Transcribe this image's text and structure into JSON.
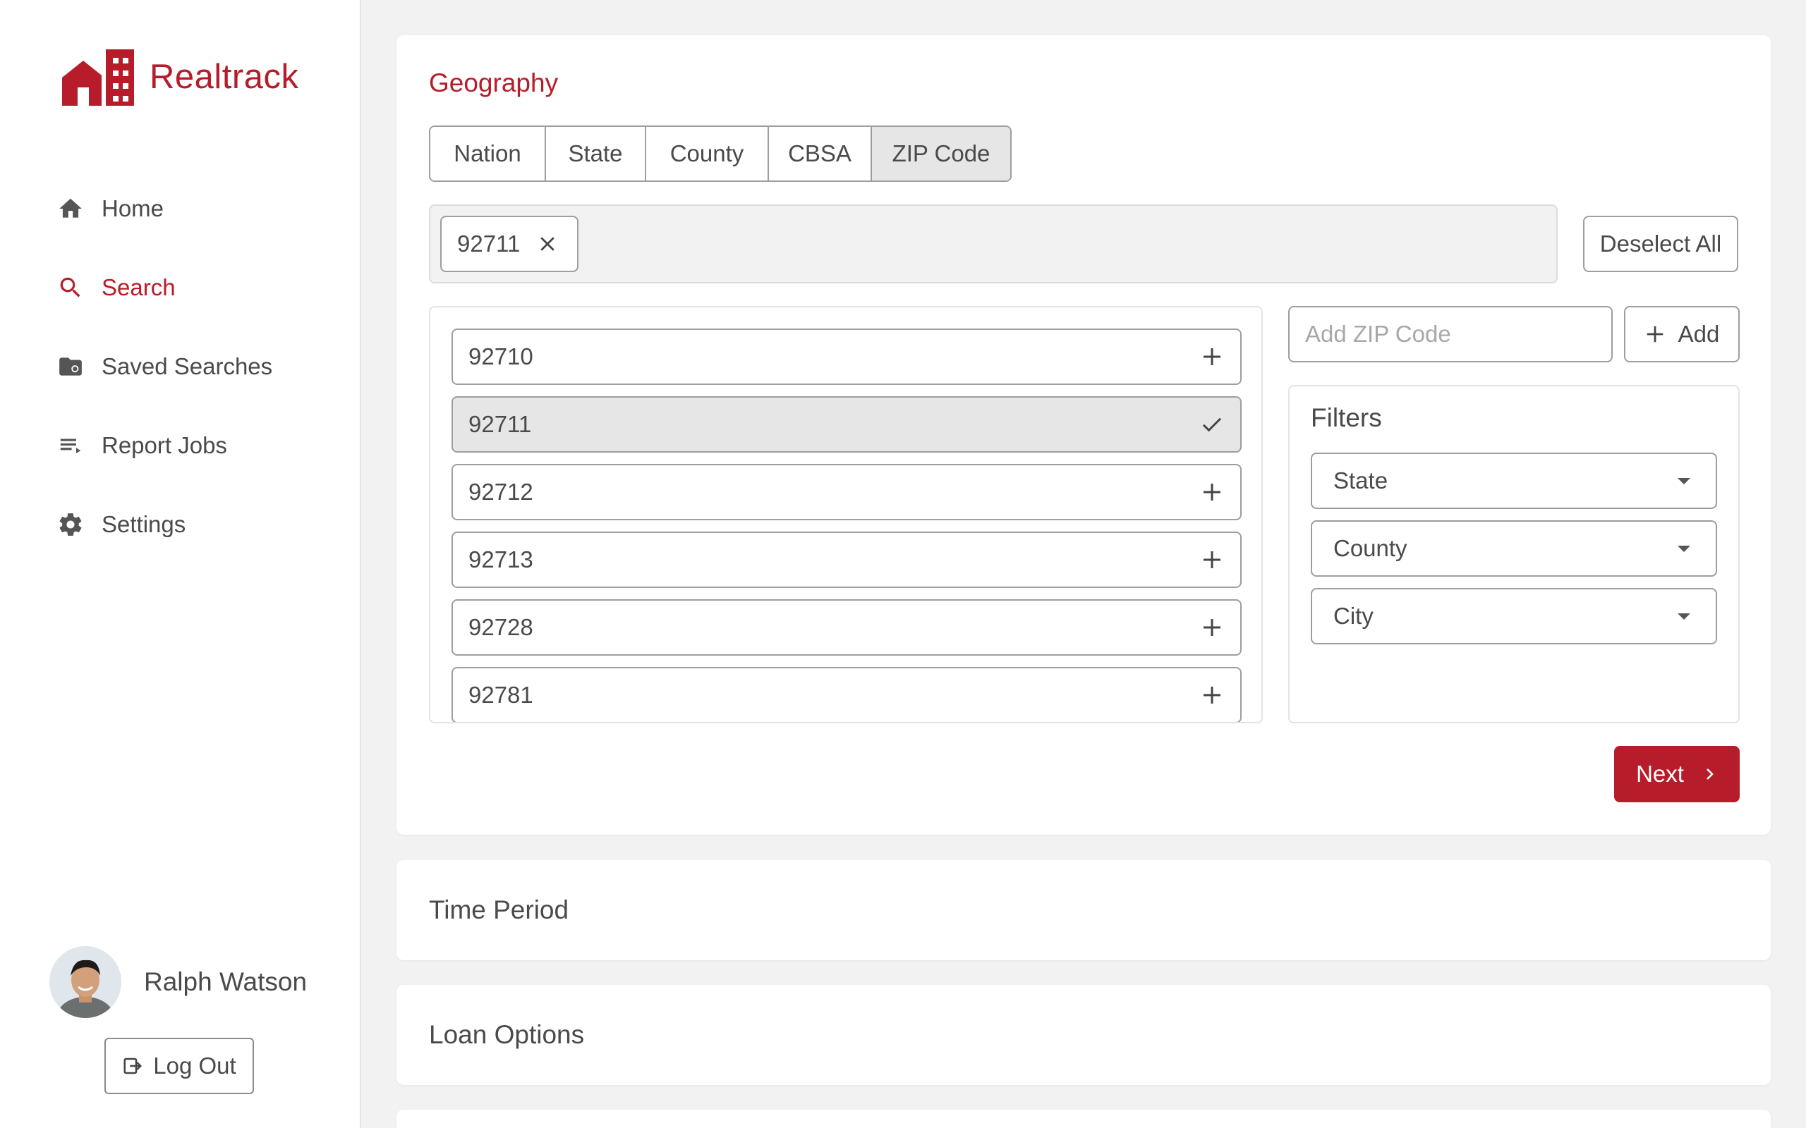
{
  "app": {
    "name": "Realtrack",
    "brand_color": "#b71c2a"
  },
  "sidebar": {
    "items": [
      {
        "label": "Home",
        "icon": "home-icon",
        "active": false
      },
      {
        "label": "Search",
        "icon": "search-icon",
        "active": true
      },
      {
        "label": "Saved Searches",
        "icon": "saved-search-folder-icon",
        "active": false
      },
      {
        "label": "Report Jobs",
        "icon": "list-icon",
        "active": false
      },
      {
        "label": "Settings",
        "icon": "gear-icon",
        "active": false
      }
    ],
    "user": {
      "name": "Ralph Watson"
    },
    "logout_label": "Log Out"
  },
  "geography": {
    "title": "Geography",
    "levels": [
      "Nation",
      "State",
      "County",
      "CBSA",
      "ZIP Code"
    ],
    "selected_level": "ZIP Code",
    "selected_chips": [
      "92711"
    ],
    "deselect_all_label": "Deselect All",
    "zip_list": [
      {
        "zip": "92710",
        "selected": false
      },
      {
        "zip": "92711",
        "selected": true
      },
      {
        "zip": "92712",
        "selected": false
      },
      {
        "zip": "92713",
        "selected": false
      },
      {
        "zip": "92728",
        "selected": false
      },
      {
        "zip": "92781",
        "selected": false
      }
    ],
    "add_zip_placeholder": "Add ZIP Code",
    "add_label": "Add",
    "filters": {
      "title": "Filters",
      "dropdowns": [
        "State",
        "County",
        "City"
      ]
    },
    "next_label": "Next"
  },
  "sections": {
    "time_period": "Time Period",
    "loan_options": "Loan Options"
  }
}
